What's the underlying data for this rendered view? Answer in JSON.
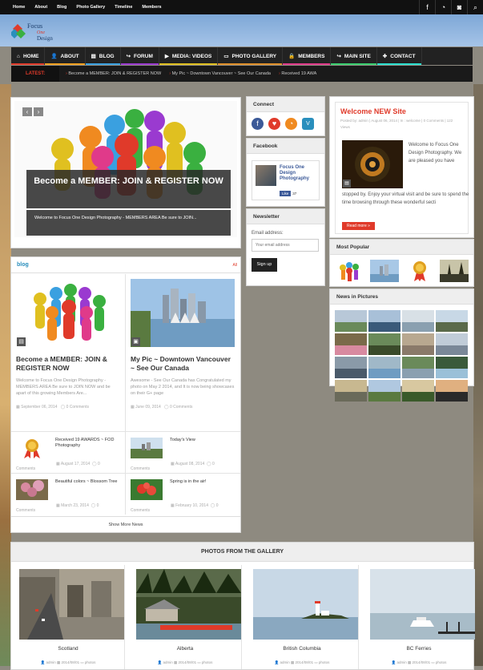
{
  "topnav": [
    "Home",
    "About",
    "Blog",
    "Photo Gallery",
    "Timeline",
    "Members"
  ],
  "topicons": [
    "facebook-icon",
    "rss-icon",
    "camera-icon",
    "search-icon"
  ],
  "logo": {
    "line1": "Focus",
    "line2": "One",
    "line3": "Design"
  },
  "mainnav": [
    {
      "label": "HOME",
      "icon": "⌂",
      "color": "#e03a2a"
    },
    {
      "label": "ABOUT",
      "icon": "👤",
      "color": "#f0a020"
    },
    {
      "label": "BLOG",
      "icon": "▤",
      "color": "#3aa0e0"
    },
    {
      "label": "FORUM",
      "icon": "↪",
      "color": "#9a3ad0"
    },
    {
      "label": "MEDIA: VIDEOS",
      "icon": "▶",
      "color": "#e0c020"
    },
    {
      "label": "PHOTO GALLERY",
      "icon": "▭",
      "color": "#e0902a"
    },
    {
      "label": "MEMBERS",
      "icon": "🔒",
      "color": "#e03a8a"
    },
    {
      "label": "MAIN SITE",
      "icon": "↪",
      "color": "#3ad070"
    },
    {
      "label": "CONTACT",
      "icon": "✚",
      "color": "#2ae0d0"
    }
  ],
  "latest": {
    "label": "LATEST:",
    "items": [
      "Become a MEMBER: JOIN & REGISTER NOW",
      "My Pic ~ Downtown Vancouver ~ See Our Canada",
      "Received 19 AWA"
    ]
  },
  "slider": {
    "title": "Become a MEMBER: JOIN & REGISTER NOW",
    "excerpt": "Welcome to Focus One Design Photography - MEMBERS AREA Be sure to JOIN...",
    "prev": "‹",
    "next": "›"
  },
  "blog": {
    "title": "blog",
    "all": "All",
    "featured": [
      {
        "title": "Become a MEMBER: JOIN & REGISTER NOW",
        "excerpt": "Welcome to Focus One Design Photography - MEMBERS AREA Be sure to JOIN NOW and be apart of this growing Members Are...",
        "date": "September 06, 2014",
        "comments": "0 Comments"
      },
      {
        "title": "My Pic ~ Downtown Vancouver ~ See Our Canada",
        "excerpt": "Awesome - See Our Canada has Congratulated my photo on May 2 2014, and It is now being showcases on their G+ page",
        "date": "June 09, 2014",
        "comments": "0 Comments"
      }
    ],
    "small": [
      {
        "title": "Received 19 AWARDS ~ FOD Photography",
        "date": "August 17, 2014",
        "comments": "0",
        "ctext": "Comments"
      },
      {
        "title": "Today's View",
        "date": "August 08, 2014",
        "comments": "0",
        "ctext": "Comments"
      },
      {
        "title": "Beautiful colors ~ Blossom Tree",
        "date": "March 23, 2014",
        "comments": "0",
        "ctext": "Comments"
      },
      {
        "title": "Spring is in the air!",
        "date": "February 10, 2014",
        "comments": "0",
        "ctext": "Comments"
      }
    ],
    "showmore": "Show More News"
  },
  "connect": {
    "title": "Connect"
  },
  "facebook": {
    "title": "Facebook",
    "page": "Focus One Design Photography",
    "like": "Like",
    "count": "37"
  },
  "newsletter": {
    "title": "Newsletter",
    "label": "Email address:",
    "placeholder": "Your email address",
    "button": "Sign up"
  },
  "welcome": {
    "title": "Welcome NEW Site",
    "meta": "Posted by: admin | August 06, 2014 | In : welcome | 0 Comments | 122 Views",
    "text_side": "Welcome to Focus One Design Photography. We are pleased you have",
    "text_full": "stopped by. Enjoy your virtual visit and be sure to spend the time browsing through these wonderful secti",
    "readmore": "Read more »"
  },
  "popular": {
    "title": "Most Popular"
  },
  "pictures": {
    "title": "News in Pictures"
  },
  "gallery": {
    "title": "PHOTOS FROM THE GALLERY",
    "items": [
      {
        "title": "Scotland",
        "author": "admin",
        "date": "2014/08/01",
        "cat": "photos"
      },
      {
        "title": "Alberta",
        "author": "admin",
        "date": "2014/08/01",
        "cat": "photos"
      },
      {
        "title": "British Columbia",
        "author": "admin",
        "date": "2014/08/01",
        "cat": "photos"
      },
      {
        "title": "BC Ferries",
        "author": "admin",
        "date": "2014/08/01",
        "cat": "photos"
      }
    ]
  }
}
